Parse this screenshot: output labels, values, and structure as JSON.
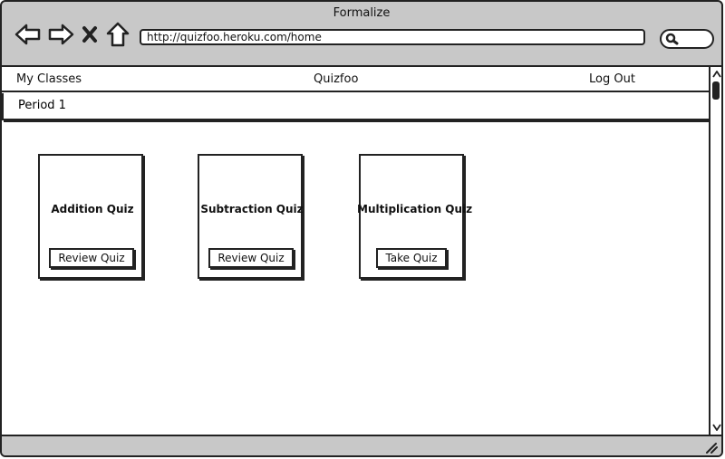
{
  "window": {
    "title": "Formalize"
  },
  "browser": {
    "url": "http://quizfoo.heroku.com/home",
    "icons": [
      "back-icon",
      "forward-icon",
      "close-icon",
      "home-icon",
      "search-icon"
    ]
  },
  "topnav": {
    "left": "My Classes",
    "center": "Quizfoo",
    "right": "Log Out"
  },
  "period": {
    "label": "Period 1"
  },
  "quizzes": [
    {
      "title": "Addition Quiz",
      "button": "Review Quiz"
    },
    {
      "title": "Subtraction Quiz",
      "button": "Review Quiz"
    },
    {
      "title": "Multiplication Quiz",
      "button": "Take Quiz"
    }
  ]
}
